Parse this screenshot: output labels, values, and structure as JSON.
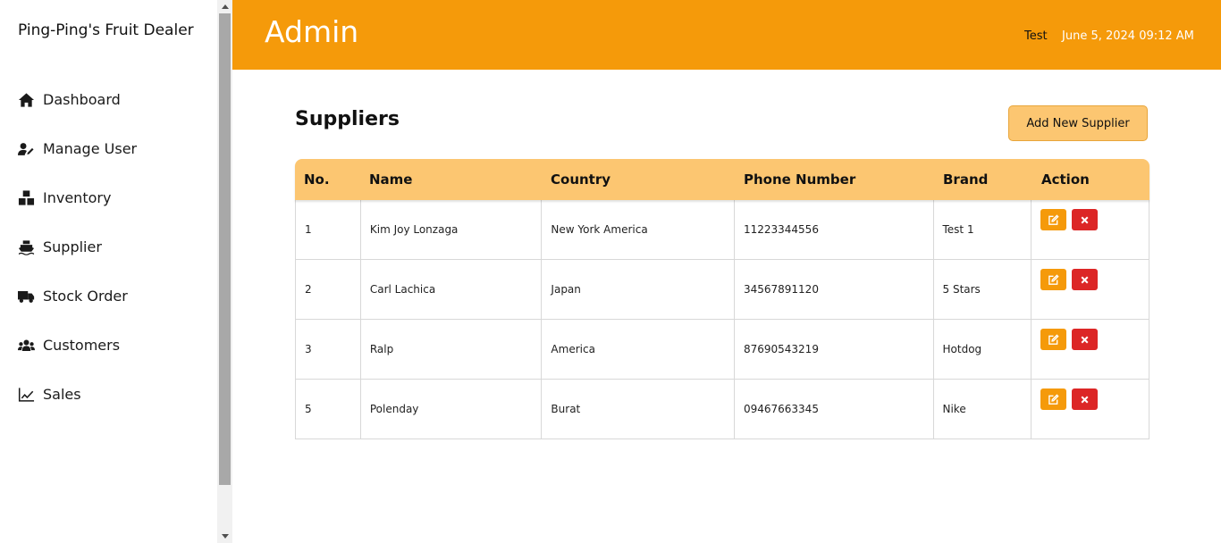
{
  "sidebar": {
    "brand": "Ping-Ping's Fruit Dealer",
    "items": [
      {
        "label": "Dashboard",
        "icon": "home-icon"
      },
      {
        "label": "Manage User",
        "icon": "user-edit-icon"
      },
      {
        "label": "Inventory",
        "icon": "boxes-icon"
      },
      {
        "label": "Supplier",
        "icon": "ship-icon"
      },
      {
        "label": "Stock Order",
        "icon": "truck-icon"
      },
      {
        "label": "Customers",
        "icon": "users-icon"
      },
      {
        "label": "Sales",
        "icon": "chart-line-icon"
      }
    ]
  },
  "header": {
    "title": "Admin",
    "user": "Test",
    "datetime": "June 5, 2024 09:12 AM"
  },
  "main": {
    "title": "Suppliers",
    "add_button": "Add New Supplier",
    "columns": [
      "No.",
      "Name",
      "Country",
      "Phone Number",
      "Brand",
      "Action"
    ],
    "rows": [
      {
        "no": "1",
        "name": "Kim Joy Lonzaga",
        "country": "New York America",
        "phone": "11223344556",
        "brand": "Test 1"
      },
      {
        "no": "2",
        "name": "Carl Lachica",
        "country": "Japan",
        "phone": "34567891120",
        "brand": "5 Stars"
      },
      {
        "no": "3",
        "name": "Ralp",
        "country": "America",
        "phone": "87690543219",
        "brand": "Hotdog"
      },
      {
        "no": "5",
        "name": "Polenday",
        "country": "Burat",
        "phone": "09467663345",
        "brand": "Nike"
      }
    ]
  },
  "colors": {
    "header": "#f59a0a",
    "accent_light": "#fcc671",
    "edit": "#f59a0a",
    "delete": "#dc2626"
  }
}
